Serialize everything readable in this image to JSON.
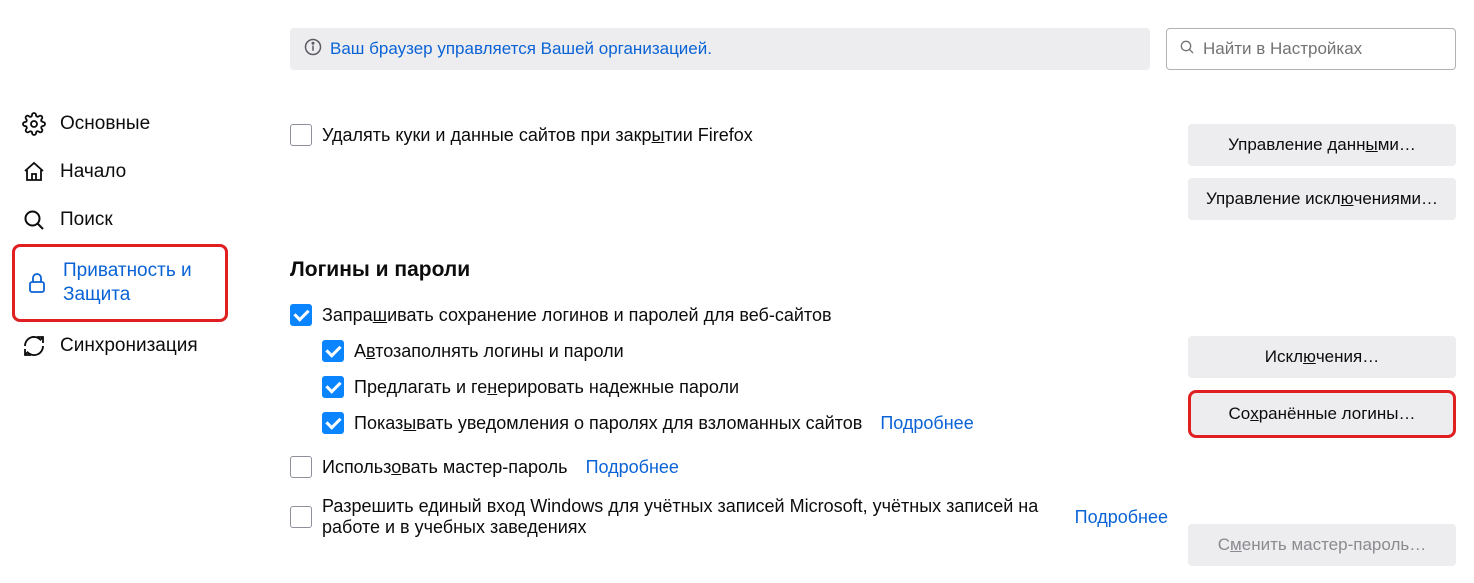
{
  "banner": {
    "text": "Ваш браузер управляется Вашей организацией."
  },
  "search": {
    "placeholder": "Найти в Настройках"
  },
  "sidebar": {
    "items": [
      {
        "label": "Основные"
      },
      {
        "label": "Начало"
      },
      {
        "label": "Поиск"
      },
      {
        "label": "Приватность и Защита"
      },
      {
        "label": "Синхронизация"
      }
    ]
  },
  "cookies": {
    "delete_on_close_pre": "Удалять куки и данные сайтов при закр",
    "delete_on_close_u": "ы",
    "delete_on_close_post": "тии Firefox",
    "manage_data_pre": "Управление данн",
    "manage_data_u": "ы",
    "manage_data_post": "ми…",
    "manage_exceptions_pre": "Управление искл",
    "manage_exceptions_u": "ю",
    "manage_exceptions_post": "чениями…"
  },
  "logins": {
    "heading": "Логины и пароли",
    "ask_save_pre": "Запра",
    "ask_save_u": "ш",
    "ask_save_post": "ивать сохранение логинов и паролей для веб-сайтов",
    "autofill_pre": "А",
    "autofill_u": "в",
    "autofill_post": "тозаполнять логины и пароли",
    "suggest_pre": "Предлагать и ге",
    "suggest_u": "н",
    "suggest_post": "ерировать надежные пароли",
    "alerts_pre": "Показ",
    "alerts_u": "ы",
    "alerts_post": "вать уведомления о паролях для взломанных сайтов",
    "master_pre": "Использ",
    "master_u": "о",
    "master_post": "вать мастер-пароль",
    "sso": "Разрешить единый вход Windows для учётных записей Microsoft, учётных записей на работе и в учебных заведениях",
    "learn_more": "Подробнее",
    "exceptions_pre": "Искл",
    "exceptions_u": "ю",
    "exceptions_post": "чения…",
    "saved_logins_pre": "Со",
    "saved_logins_u": "х",
    "saved_logins_post": "ранённые логины…",
    "change_master_pre": "С",
    "change_master_u": "м",
    "change_master_post": "енить мастер-пароль…"
  }
}
